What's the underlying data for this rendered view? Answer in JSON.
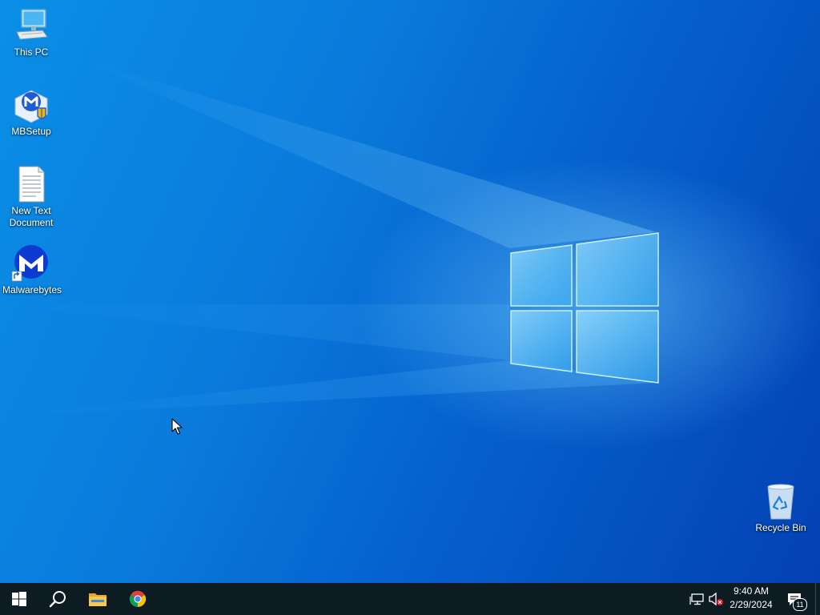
{
  "desktop": {
    "icons": [
      {
        "label": "This PC",
        "icon": "computer-icon"
      },
      {
        "label": "MBSetup",
        "icon": "malwarebytes-setup-icon"
      },
      {
        "label": "New Text Document",
        "icon": "text-document-icon"
      },
      {
        "label": "Malwarebytes",
        "icon": "malwarebytes-icon"
      },
      {
        "label": "Recycle Bin",
        "icon": "recycle-bin-icon"
      }
    ],
    "colors": {
      "wallpaper_light": "#0a8fe6",
      "wallpaper_dark": "#0441b4",
      "taskbar": "#0d1b22"
    }
  },
  "taskbar": {
    "pinned": [
      {
        "name": "Start",
        "icon": "windows-start-icon"
      },
      {
        "name": "Search",
        "icon": "search-icon"
      },
      {
        "name": "File Explorer",
        "icon": "folder-icon"
      },
      {
        "name": "Google Chrome",
        "icon": "chrome-icon"
      }
    ],
    "tray": {
      "network_icon": "network-icon",
      "volume_icon": "volume-muted-icon",
      "time": "9:40 AM",
      "date": "2/29/2024",
      "notification_count": "11"
    }
  }
}
